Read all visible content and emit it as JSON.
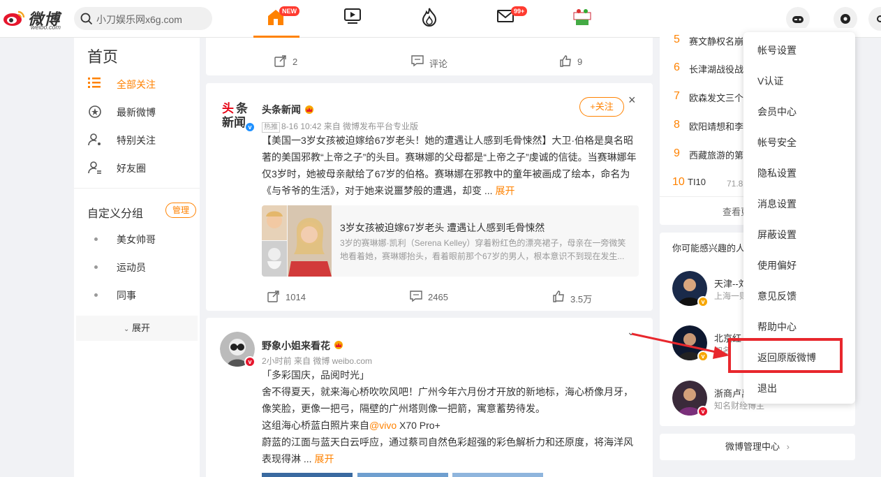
{
  "header": {
    "brand": "微博",
    "site": "weibo.com",
    "search_placeholder": "小刀娱乐网x6g.com",
    "home_badge": "NEW",
    "mail_badge": "99+"
  },
  "left_nav": {
    "title": "首页",
    "items": [
      {
        "label": "全部关注"
      },
      {
        "label": "最新微博"
      },
      {
        "label": "特别关注"
      },
      {
        "label": "好友圈"
      }
    ],
    "group_title": "自定义分组",
    "manage_label": "管理",
    "groups": [
      {
        "label": "美女帅哥"
      },
      {
        "label": "运动员"
      },
      {
        "label": "同事"
      }
    ],
    "expand_label": "展开"
  },
  "feed": {
    "post0": {
      "repost": "2",
      "comment": "评论",
      "like": "9"
    },
    "post1": {
      "author": "头条新闻",
      "avatar_text": "头条新闻",
      "tag": "热推",
      "meta": "8-16 10:42  来自 微博发布平台专业版",
      "follow": "+关注",
      "close": "×",
      "text": "【美国一3岁女孩被迫嫁给67岁老头！她的遭遇让人感到毛骨悚然】大卫·伯格是臭名昭著的美国邪教“上帝之子”的头目。赛琳娜的父母都是“上帝之子”虔诚的信徒。当赛琳娜年仅3岁时，她被母亲献给了67岁的伯格。赛琳娜在邪教中的童年被画成了绘本，命名为《与爷爷的生活》，对于她来说噩梦般的遭遇，却变 ... ",
      "more": "展开",
      "link_title": "3岁女孩被迫嫁67岁老头 遭遇让人感到毛骨悚然",
      "link_desc": "3岁的赛琳娜·凯利（Serena Kelley）穿着粉红色的漂亮裙子，母亲在一旁微笑地看着她，赛琳娜抬头，看着眼前那个67岁的男人，根本意识不到现在发生...",
      "repost": "1014",
      "comment": "2465",
      "like": "3.5万"
    },
    "post2": {
      "author": "野象小姐来看花",
      "meta": "2小时前  来自 微博 weibo.com",
      "line1": "「多彩国庆，品阅时光」",
      "line2": "舍不得夏天，就来海心桥吹吹风吧！广州今年六月份才开放的新地标，海心桥像月牙，像笑脸，更像一把弓，隔壁的广州塔则像一把箭，寓意蓄势待发。",
      "line3_pre": "这组海心桥蓝白照片来自",
      "line3_link": "@vivo",
      "line3_post": " X70 Pro+",
      "line4": "蔚蓝的江面与蓝天白云呼应，通过蔡司自然色彩超强的彩色解析力和还原度，将海洋风表现得淋 ... ",
      "more": "展开"
    }
  },
  "right": {
    "hot": [
      {
        "n": "5",
        "t": "赛文静权名崩赛",
        "c": ""
      },
      {
        "n": "6",
        "t": "长津湖战役战利",
        "c": ""
      },
      {
        "n": "7",
        "t": "欧森发文三个不",
        "c": ""
      },
      {
        "n": "8",
        "t": "欧阳靖想和李活",
        "c": ""
      },
      {
        "n": "9",
        "t": "西藏旅游的第一",
        "c": ""
      },
      {
        "n": "10",
        "t": "TI10",
        "c": "71.8万"
      }
    ],
    "view_more": "查看更",
    "suggest_title": "你可能感兴趣的人",
    "suggest": [
      {
        "name": "天津--刘",
        "desc": "上海一则"
      },
      {
        "name": "北京红",
        "desc": "知名"
      },
      {
        "name": "浙商卢禹",
        "desc": "知名财经博主"
      }
    ],
    "manage_center": "微博管理中心"
  },
  "menu": {
    "items": [
      "帐号设置",
      "V认证",
      "会员中心",
      "帐号安全",
      "隐私设置",
      "消息设置",
      "屏蔽设置",
      "使用偏好",
      "意见反馈",
      "帮助中心",
      "返回原版微博",
      "退出"
    ]
  },
  "colors": {
    "accent": "#ff8200",
    "highlight": "#e8272d"
  }
}
